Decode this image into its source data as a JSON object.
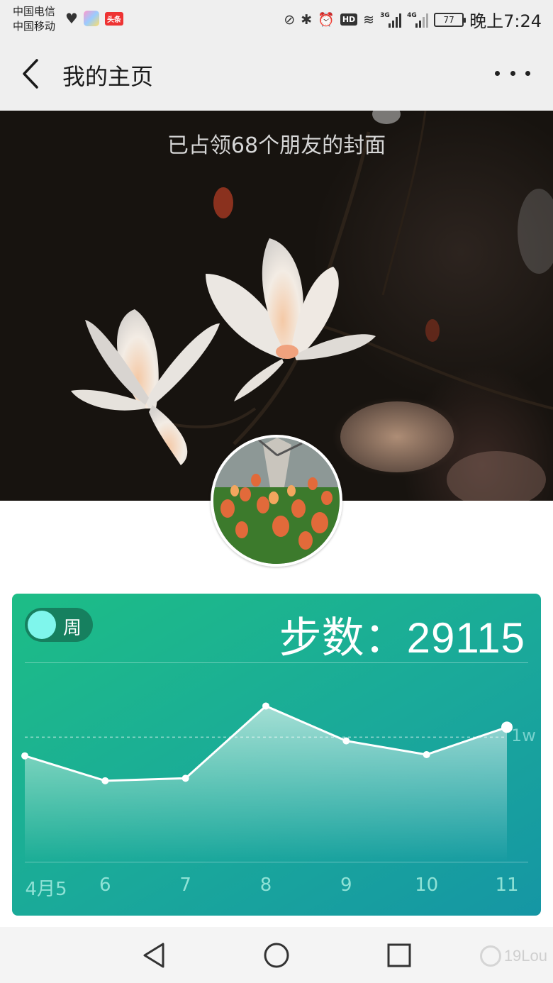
{
  "status_bar": {
    "carrier_1": "中国电信",
    "carrier_2": "中国移动",
    "network_1": "3G",
    "network_2": "4G",
    "hd_label": "HD",
    "battery": "77",
    "time": "晚上7:24"
  },
  "header": {
    "title": "我的主页"
  },
  "cover": {
    "caption": "已占领68个朋友的封面"
  },
  "steps_card": {
    "toggle_label": "周",
    "steps_label": "步数：",
    "steps_value": "29115",
    "reference_label": "1w"
  },
  "chart_data": {
    "type": "area",
    "categories": [
      "4月5",
      "6",
      "7",
      "8",
      "9",
      "10",
      "11"
    ],
    "values": [
      8500,
      6500,
      6700,
      12500,
      9700,
      8600,
      10800
    ],
    "reference_line": 10000,
    "ylim": [
      0,
      16000
    ],
    "grid": false,
    "legend": "none"
  },
  "watermark": {
    "text": "19Lou"
  },
  "colors": {
    "card_start": "#1dbd86",
    "card_end": "#1596a4",
    "toggle_knob": "#7ff6ec"
  }
}
